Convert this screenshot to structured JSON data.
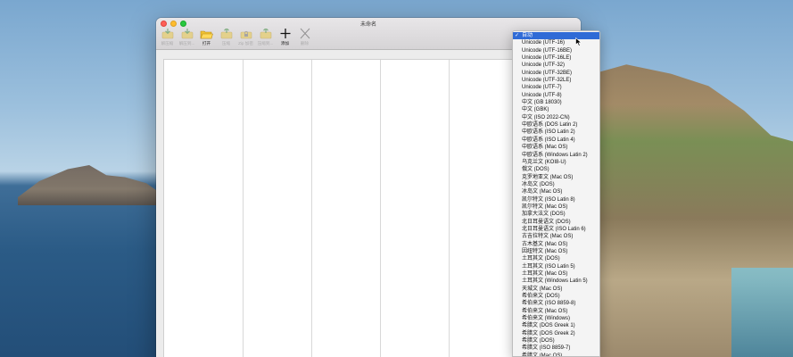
{
  "window": {
    "title": "未命名"
  },
  "toolbar": {
    "buttons": [
      {
        "label": "解压缩",
        "icon": "extract-icon",
        "enabled": false
      },
      {
        "label": "解压到...",
        "icon": "extract-to-icon",
        "enabled": false
      },
      {
        "label": "打开",
        "icon": "open-folder-icon",
        "enabled": true
      },
      {
        "label": "压缩",
        "icon": "compress-icon",
        "enabled": false
      },
      {
        "label": "Zip 加密",
        "icon": "zip-encrypt-icon",
        "enabled": false
      },
      {
        "label": "压缩到...",
        "icon": "compress-to-icon",
        "enabled": false
      },
      {
        "label": "添加",
        "icon": "add-icon",
        "enabled": true
      },
      {
        "label": "删除",
        "icon": "delete-icon",
        "enabled": false
      }
    ]
  },
  "encoding_menu": {
    "selected_index": 0,
    "items": [
      "自动",
      "Unicode (UTF-16)",
      "Unicode (UTF-16BE)",
      "Unicode (UTF-16LE)",
      "Unicode (UTF-32)",
      "Unicode (UTF-32BE)",
      "Unicode (UTF-32LE)",
      "Unicode (UTF-7)",
      "Unicode (UTF-8)",
      "中文 (GB 18030)",
      "中文 (GBK)",
      "中文 (ISO 2022-CN)",
      "中欧语系 (DOS Latin 2)",
      "中欧语系 (ISO Latin 2)",
      "中欧语系 (ISO Latin 4)",
      "中欧语系 (Mac OS)",
      "中欧语系 (Windows Latin 2)",
      "乌克兰文 (KOI8-U)",
      "俄文 (DOS)",
      "克罗地亚文 (Mac OS)",
      "冰岛文 (DOS)",
      "冰岛文 (Mac OS)",
      "凯尔特文 (ISO Latin 8)",
      "凯尔特文 (Mac OS)",
      "加拿大法文 (DOS)",
      "北日耳曼语文 (DOS)",
      "北日耳曼语文 (ISO Latin 6)",
      "古吉拉特文 (Mac OS)",
      "古木基文 (Mac OS)",
      "因纽特文 (Mac OS)",
      "土耳其文 (DOS)",
      "土耳其文 (ISO Latin 5)",
      "土耳其文 (Mac OS)",
      "土耳其文 (Windows Latin 5)",
      "天城文 (Mac OS)",
      "希伯来文 (DOS)",
      "希伯来文 (ISO 8859-8)",
      "希伯来文 (Mac OS)",
      "希伯来文 (Windows)",
      "希腊文 (DOS Greek 1)",
      "希腊文 (DOS Greek 2)",
      "希腊文 (DOS)",
      "希腊文 (ISO 8859-7)",
      "希腊文 (Mac OS)"
    ]
  }
}
